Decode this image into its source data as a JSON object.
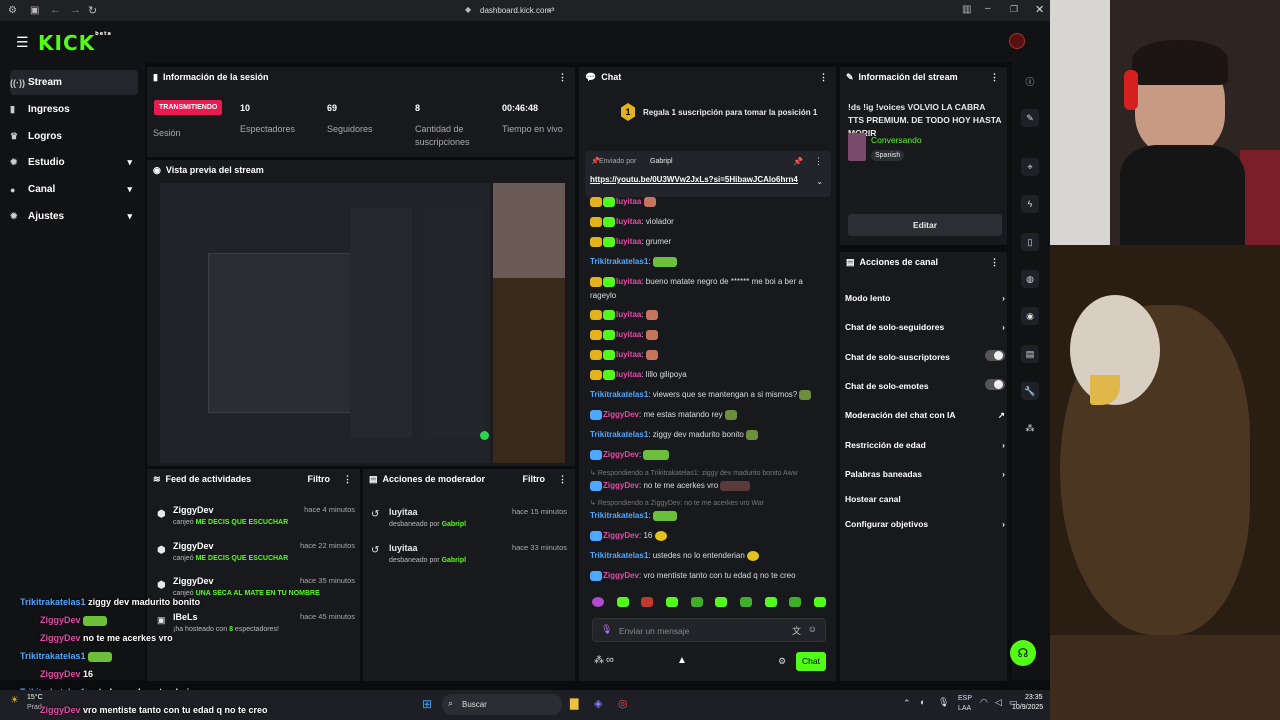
{
  "browser": {
    "url": "dashboard.kick.com"
  },
  "brand": {
    "logo": "KICK",
    "beta": "beta",
    "accent": "#53fc18"
  },
  "sidebar": {
    "items": [
      {
        "label": "Stream",
        "icon": "broadcast-icon"
      },
      {
        "label": "Ingresos",
        "icon": "chart-icon"
      },
      {
        "label": "Logros",
        "icon": "trophy-icon"
      },
      {
        "label": "Estudio",
        "icon": "gear-icon"
      },
      {
        "label": "Canal",
        "icon": "user-icon"
      },
      {
        "label": "Ajustes",
        "icon": "gear-icon"
      }
    ]
  },
  "session": {
    "title": "Información de la sesión",
    "status": "TRANSMITIENDO",
    "status_label": "Sesión",
    "viewers": "10",
    "viewers_label": "Espectadores",
    "followers": "69",
    "followers_label": "Seguidores",
    "subs": "8",
    "subs_label": "Cantidad de suscripciones",
    "uptime": "00:46:48",
    "uptime_label": "Tiempo en vivo"
  },
  "preview": {
    "title": "Vista previa del stream"
  },
  "feed": {
    "title": "Feed de actividades",
    "filter": "Filtro",
    "items": [
      {
        "user": "ZiggyDev",
        "time": "hace 4 minutos",
        "action": "canjeó",
        "reward": "ME DECIS QUE ESCUCHAR"
      },
      {
        "user": "ZiggyDev",
        "time": "hace 22 minutos",
        "action": "canjeó",
        "reward": "ME DECIS QUE ESCUCHAR"
      },
      {
        "user": "ZiggyDev",
        "time": "hace 35 minutos",
        "action": "canjeó",
        "reward": "UNA SECA AL MATE EN TU NOMBRE"
      },
      {
        "user": "lBeLs",
        "time": "hace 45 minutos",
        "action": "¡ha hosteado con",
        "count": "8",
        "tail": "espectadores!"
      }
    ]
  },
  "mod": {
    "title": "Acciones de moderador",
    "filter": "Filtro",
    "items": [
      {
        "user": "luyitaa",
        "time": "hace 15 minutos",
        "action": "desbaneado por",
        "by": "Gabripl"
      },
      {
        "user": "luyitaa",
        "time": "hace 33 minutos",
        "action": "desbaneado por",
        "by": "Gabripl"
      }
    ]
  },
  "chat": {
    "title": "Chat",
    "gift_text": "Regala 1 suscripción para tomar la posición 1",
    "gift_rank": "1",
    "pinned_by_label": "Enviado por",
    "pinned_by": "Gabripl",
    "pinned_link": "https://youtu.be/0U3WVw2JxLs?si=5HibawJCAlo6hrn4",
    "messages": [
      {
        "user": "luyitaa",
        "text": ""
      },
      {
        "user": "luyitaa",
        "text": ": violador"
      },
      {
        "user": "luyitaa",
        "text": ": grumer"
      },
      {
        "user": "Trikitrakatelas1",
        "text": ":"
      },
      {
        "user": "luyitaa",
        "text": ": bueno matate negro de ****** me boi a ber a"
      },
      {
        "user": "",
        "text": "rageylo"
      },
      {
        "user": "luyitaa",
        "text": ":"
      },
      {
        "user": "luyitaa",
        "text": ":"
      },
      {
        "user": "luyitaa",
        "text": ":"
      },
      {
        "user": "luyitaa",
        "text": ": lillo gilipoya"
      },
      {
        "user": "Trikitrakatelas1",
        "text": ": viewers que se mantengan a si mismos?"
      },
      {
        "user": "ZiggyDev",
        "text": ": me estas matando rey"
      },
      {
        "user": "Trikitrakatelas1",
        "text": ": ziggy dev madurito bonito"
      },
      {
        "user": "ZiggyDev",
        "text": ":"
      },
      {
        "user": "",
        "text": "Respondiendo a Trikitrakatelas1: ziggy dev madurito bonito Aww"
      },
      {
        "user": "ZiggyDev",
        "text": ": no te me acerkes vro"
      },
      {
        "user": "",
        "text": "Respondiendo a ZiggyDev: no te me acerkes vro War"
      },
      {
        "user": "Trikitrakatelas1",
        "text": ":"
      },
      {
        "user": "ZiggyDev",
        "text": ": 16"
      },
      {
        "user": "Trikitrakatelas1",
        "text": ": ustedes no lo entenderian"
      },
      {
        "user": "ZiggyDev",
        "text": ": vro mentiste tanto con tu edad q no te creo"
      }
    ],
    "input_placeholder": "Enviar un mensaje",
    "send_label": "Chat",
    "infinity": "∞"
  },
  "stream_info": {
    "title": "Información del stream",
    "stream_title": "!ds !ig !voices VOLVIO LA CABRA TTS PREMIUM. DE TODO HOY HASTA MORIR",
    "category": "Conversando",
    "language": "Spanish",
    "edit_label": "Editar"
  },
  "channel_actions": {
    "title": "Acciones de canal",
    "items": [
      {
        "label": "Modo lento",
        "control": "chevron"
      },
      {
        "label": "Chat de solo-seguidores",
        "control": "chevron"
      },
      {
        "label": "Chat de solo-suscriptores",
        "control": "toggle"
      },
      {
        "label": "Chat de solo-emotes",
        "control": "toggle"
      },
      {
        "label": "Moderación del chat con IA",
        "control": "external"
      },
      {
        "label": "Restricción de edad",
        "control": "chevron"
      },
      {
        "label": "Palabras baneadas",
        "control": "chevron"
      },
      {
        "label": "Hostear canal",
        "control": "none"
      },
      {
        "label": "Configurar objetivos",
        "control": "chevron"
      }
    ]
  },
  "overlay_chat": [
    {
      "user": "Trikitrakatelas1",
      "text": "ziggy dev madurito bonito"
    },
    {
      "user": "ZiggyDev",
      "text": ""
    },
    {
      "user": "ZiggyDev",
      "text": "no te me acerkes vro"
    },
    {
      "user": "Trikitrakatelas1",
      "text": ""
    },
    {
      "user": "ZiggyDev",
      "text": "16"
    },
    {
      "user": "Trikitrakatelas1",
      "text": "ustedes no lo entenderian"
    },
    {
      "user": "ZiggyDev",
      "text": "vro mentiste tanto con tu edad q no te creo"
    }
  ],
  "taskbar": {
    "search": "Buscar",
    "weather": "15°C",
    "weather_desc": "Prad",
    "lang1": "ESP",
    "lang2": "LAA",
    "time": "23:35",
    "date": "10/9/2025"
  }
}
